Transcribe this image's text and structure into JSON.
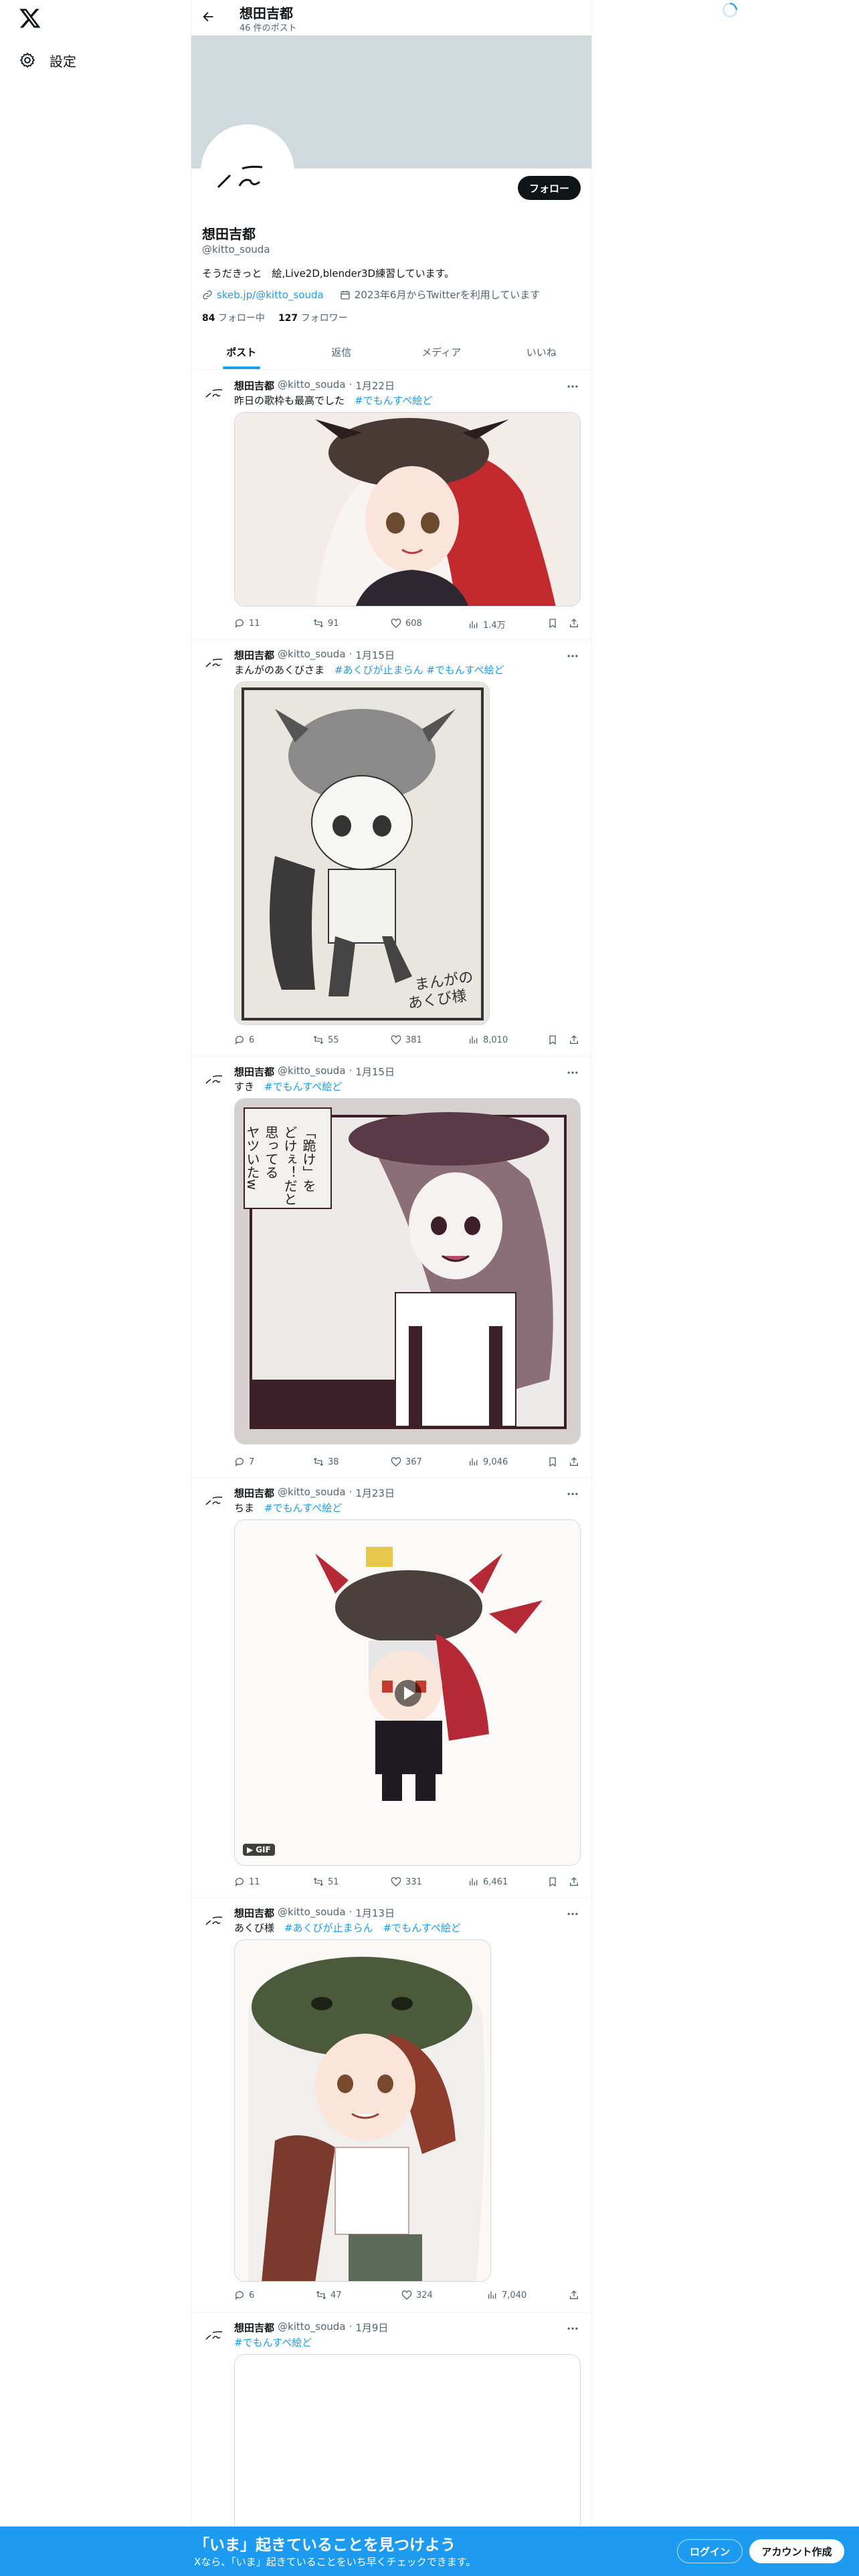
{
  "nav": {
    "settings_label": "設定"
  },
  "header": {
    "name": "想田吉都",
    "post_count": "46 件のポスト"
  },
  "profile": {
    "follow_label": "フォロー",
    "name": "想田吉都",
    "handle": "@kitto_souda",
    "bio": "そうだきっと　絵,Live2D,blender3D練習しています。",
    "link": "skeb.jp/@kitto_souda",
    "joined": "2023年6月からTwitterを利用しています",
    "following_count": "84",
    "following_label": "フォロー中",
    "followers_count": "127",
    "followers_label": "フォロワー"
  },
  "tabs": [
    {
      "label": "ポスト"
    },
    {
      "label": "返信"
    },
    {
      "label": "メディア"
    },
    {
      "label": "いいね"
    }
  ],
  "posts": [
    {
      "name": "想田吉都",
      "handle": "@kitto_souda",
      "date": "1月22日",
      "text": "昨日の歌枠も最高でした",
      "tags": "#でもんすぺ絵ど",
      "replies": "11",
      "reposts": "91",
      "likes": "608",
      "views": "1.4万"
    },
    {
      "name": "想田吉都",
      "handle": "@kitto_souda",
      "date": "1月15日",
      "text": "まんがのあくびさま",
      "tags": "#あくびが止まらん #でもんすぺ絵ど",
      "replies": "6",
      "reposts": "55",
      "likes": "381",
      "views": "8,010"
    },
    {
      "name": "想田吉都",
      "handle": "@kitto_souda",
      "date": "1月15日",
      "text": "すき",
      "tags": "#でもんすぺ絵ど",
      "replies": "7",
      "reposts": "38",
      "likes": "367",
      "views": "9,046"
    },
    {
      "name": "想田吉都",
      "handle": "@kitto_souda",
      "date": "1月23日",
      "text": "ちま",
      "tags": "#でもんすぺ絵ど",
      "replies": "11",
      "reposts": "51",
      "likes": "331",
      "views": "6,461",
      "gif_label": "GIF"
    },
    {
      "name": "想田吉都",
      "handle": "@kitto_souda",
      "date": "1月13日",
      "text": "あくび様",
      "tags": "#あくびが止まらん　#でもんすぺ絵ど",
      "replies": "6",
      "reposts": "47",
      "likes": "324",
      "views": "7,040"
    },
    {
      "name": "想田吉都",
      "handle": "@kitto_souda",
      "date": "1月9日",
      "text": "",
      "tags": "#でもんすぺ絵ど"
    }
  ],
  "bottom": {
    "title": "「いま」起きていることを見つけよう",
    "subtitle": "Xなら、「いま」起きていることをいち早くチェックできます。",
    "login_label": "ログイン",
    "signup_label": "アカウント作成"
  },
  "colors": {
    "accent": "#1d9bf0",
    "text": "#0f1419",
    "muted": "#536471",
    "banner": "#cfd9de"
  }
}
